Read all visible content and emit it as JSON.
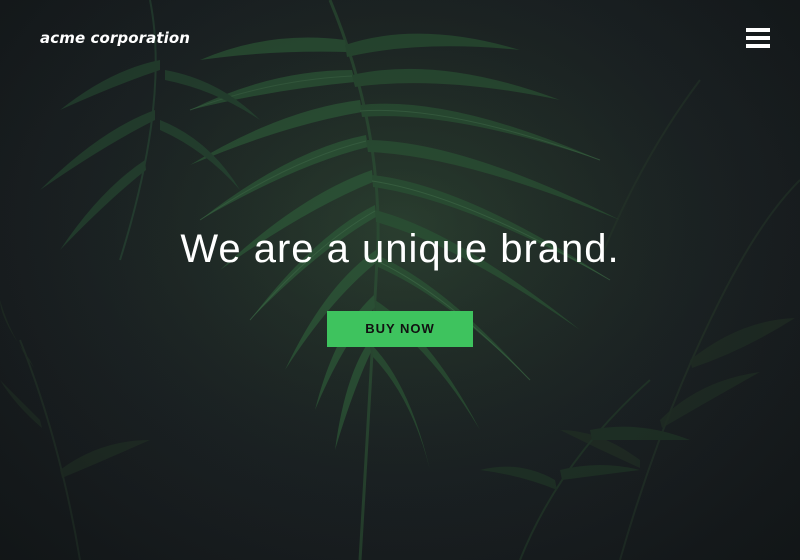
{
  "header": {
    "logo_text": "acme corporation",
    "menu_icon": "hamburger-menu-icon"
  },
  "hero": {
    "headline": "We are a unique brand.",
    "cta_label": "BUY NOW",
    "background": "dark tropical palm fronds photo"
  },
  "colors": {
    "accent": "#3ec35e",
    "text": "#ffffff",
    "background": "#1c2124"
  }
}
